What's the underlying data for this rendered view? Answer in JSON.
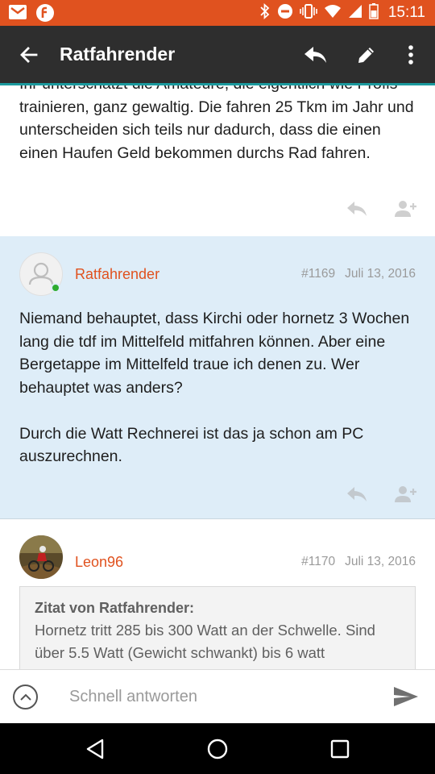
{
  "status_bar": {
    "time": "15:11"
  },
  "app_bar": {
    "title": "Ratfahrender"
  },
  "posts": [
    {
      "text": "Ihr unterschätzt die Amateure, die eigentlich wie Profis trainieren, ganz gewaltig. Die fahren 25 Tkm im Jahr und unterscheiden sich teils nur dadurch, dass die einen einen Haufen Geld bekommen durchs Rad fahren."
    },
    {
      "author": "Ratfahrender",
      "number": "#1169",
      "date": "Juli 13, 2016",
      "text_p1": "Niemand behauptet, dass Kirchi oder hornetz 3 Wochen lang die tdf im Mittelfeld mitfahren können. Aber eine Bergetappe im Mittelfeld traue ich denen zu. Wer behauptet was anders?",
      "text_p2": "Durch die Watt Rechnerei ist das ja schon am PC auszurechnen."
    },
    {
      "author": "Leon96",
      "number": "#1170",
      "date": "Juli 13, 2016",
      "quote_author": "Zitat von Ratfahrender:",
      "quote_text": "Hornetz tritt 285 bis 300 Watt an der Schwelle. Sind über 5.5 Watt (Gewicht schwankt) bis 6 watt"
    }
  ],
  "reply": {
    "placeholder": "Schnell antworten"
  },
  "colors": {
    "accent": "#e0521f",
    "appbar": "#2e2e2e",
    "teal": "#1c9a9e",
    "highlight_bg": "#deedf8"
  }
}
